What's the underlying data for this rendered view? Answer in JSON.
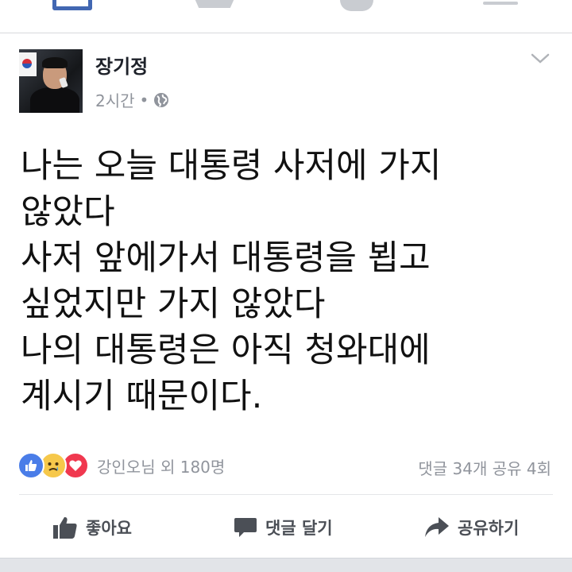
{
  "post": {
    "author": "장기정",
    "time": "2시간",
    "separator": "•",
    "privacy_icon": "globe-icon",
    "text_lines": [
      "나는 오늘 대통령 사저에 가지",
      "않았다",
      "사저 앞에가서 대통령을 뵙고",
      "싶었지만 가지 않았다",
      "나의 대통령은 아직 청와대에",
      "계시기 때문이다."
    ]
  },
  "reactions": {
    "icons": [
      "like-icon",
      "sad-icon",
      "love-icon"
    ],
    "summary": "강인오님 외 180명",
    "counts": "댓글 34개 공유 4회"
  },
  "actions": {
    "like": "좋아요",
    "comment": "댓글 달기",
    "share": "공유하기"
  },
  "colors": {
    "accent": "#4267b2",
    "muted": "#90949c",
    "like": "#4a7de8",
    "sad": "#f6c84b",
    "love": "#f0384f"
  }
}
